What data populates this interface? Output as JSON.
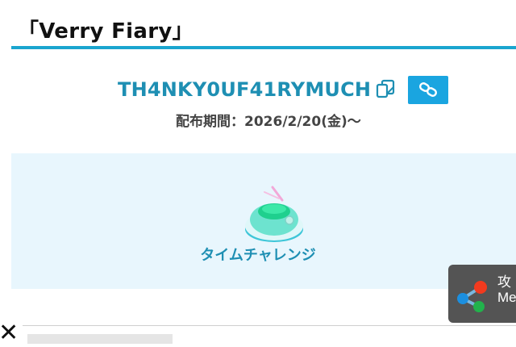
{
  "section": {
    "title": "「Verry Fiary」"
  },
  "code": {
    "value": "TH4NKY0UF41RYMUCH",
    "copy_icon": "copy-icon",
    "link_icon": "link-icon",
    "period": "配布期間：2026/2/20(金)〜"
  },
  "reward": {
    "icon": "time-challenge-item-icon",
    "label": "タイムチャレンジ"
  },
  "share": {
    "icon": "share-icon",
    "line1": "攻",
    "line2": "Me"
  },
  "colors": {
    "accent": "#1aa5cf",
    "code_text": "#1e8fb3",
    "panel_bg": "#e8f6fd"
  }
}
